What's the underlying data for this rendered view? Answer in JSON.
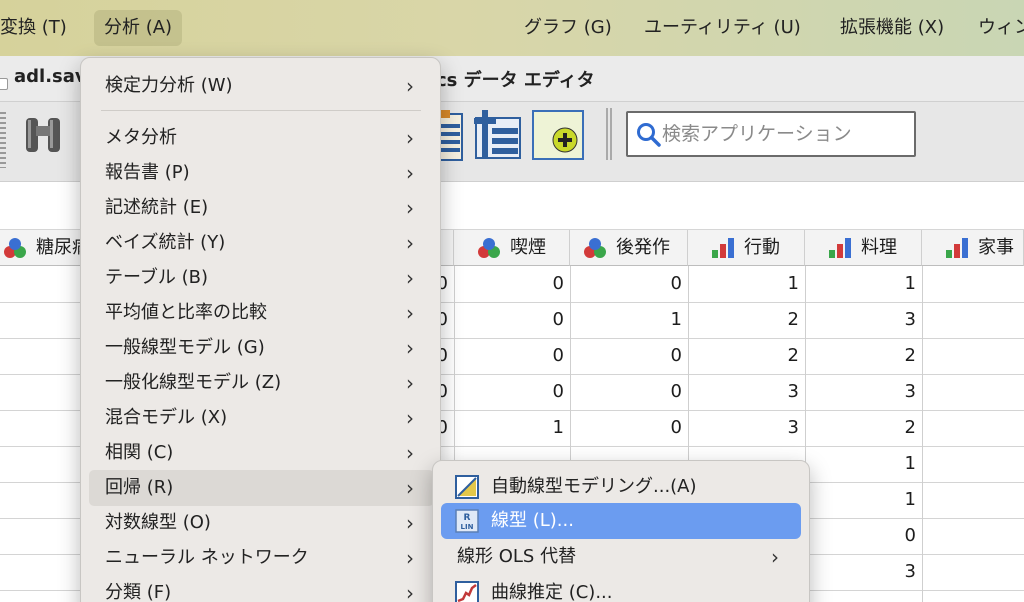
{
  "menubar": {
    "items": [
      "変換 (T)",
      "分析 (A)",
      "グラフ (G)",
      "ユーティリティ (U)",
      "拡張機能 (X)",
      "ウィン"
    ]
  },
  "window": {
    "file": "adl.sav",
    "title_tail": "cs データ エディタ"
  },
  "toolbar": {
    "search_placeholder": "検索アプリケーション"
  },
  "grid": {
    "columns": [
      {
        "label": "糖尿病",
        "icon": "nominal-icon"
      },
      {
        "label": "喫煙",
        "icon": "nominal-icon"
      },
      {
        "label": "後発作",
        "icon": "nominal-icon"
      },
      {
        "label": "行動",
        "icon": "ordinal-icon"
      },
      {
        "label": "料理",
        "icon": "ordinal-icon"
      },
      {
        "label": "家事",
        "icon": "ordinal-icon"
      }
    ],
    "rows": [
      {
        "c0": "0",
        "smoke": "0",
        "after": "0",
        "act": "1",
        "cook": "1"
      },
      {
        "c0": "0",
        "smoke": "0",
        "after": "1",
        "act": "2",
        "cook": "3"
      },
      {
        "c0": "0",
        "smoke": "0",
        "after": "0",
        "act": "2",
        "cook": "2"
      },
      {
        "c0": "0",
        "smoke": "0",
        "after": "0",
        "act": "3",
        "cook": "3"
      },
      {
        "c0": "0",
        "smoke": "1",
        "after": "0",
        "act": "3",
        "cook": "2"
      },
      {
        "c0": "",
        "smoke": "",
        "after": "",
        "act": "",
        "cook": "1"
      },
      {
        "c0": "",
        "smoke": "",
        "after": "",
        "act": "",
        "cook": "1"
      },
      {
        "c0": "",
        "smoke": "",
        "after": "",
        "act": "",
        "cook": "0"
      },
      {
        "c0": "",
        "smoke": "",
        "after": "",
        "act": "",
        "cook": "3"
      }
    ]
  },
  "analyze_menu": {
    "items": [
      "検定力分析 (W)",
      "メタ分析",
      "報告書 (P)",
      "記述統計 (E)",
      "ベイズ統計 (Y)",
      "テーブル (B)",
      "平均値と比率の比較",
      "一般線型モデル (G)",
      "一般化線型モデル (Z)",
      "混合モデル (X)",
      "相関 (C)",
      "回帰 (R)",
      "対数線型 (O)",
      "ニューラル ネットワーク",
      "分類 (F)"
    ],
    "highlighted": "回帰 (R)"
  },
  "regression_submenu": {
    "items": [
      {
        "label": "自動線型モデリング...(A)",
        "icon": "auto-linear-icon"
      },
      {
        "label": "線型 (L)...",
        "icon": "linear-regression-icon"
      },
      {
        "label": "線形 OLS 代替",
        "icon": ""
      },
      {
        "label": "曲線推定 (C)...",
        "icon": "curve-estimation-icon"
      }
    ],
    "selected": "線型 (L)...",
    "rlin_badge_top": "R",
    "rlin_badge_bottom": "LIN"
  },
  "colors": {
    "selection": "#6b9cf0",
    "menu_bg": "#ece9e6",
    "menubar_bg": "#d6d29b"
  }
}
